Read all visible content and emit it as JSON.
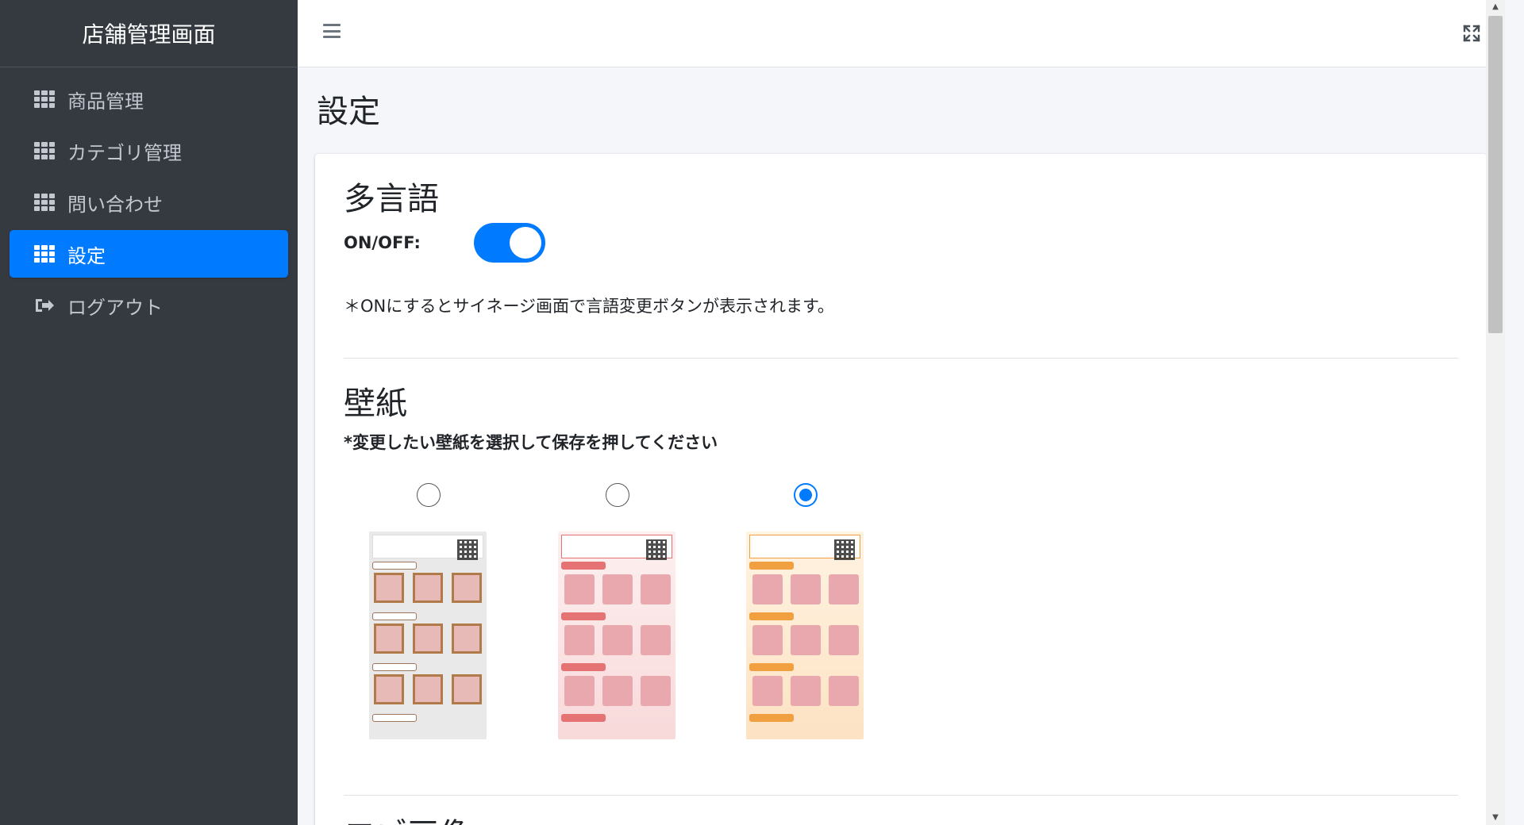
{
  "sidebar": {
    "brand": "店舗管理画面",
    "items": [
      {
        "label": "商品管理",
        "icon": "grid-icon"
      },
      {
        "label": "カテゴリ管理",
        "icon": "grid-icon"
      },
      {
        "label": "問い合わせ",
        "icon": "grid-icon"
      },
      {
        "label": "設定",
        "icon": "grid-icon",
        "active": true
      },
      {
        "label": "ログアウト",
        "icon": "sign-out-icon"
      }
    ]
  },
  "topbar": {
    "menu_icon": "hamburger-icon",
    "fullscreen_icon": "expand-icon"
  },
  "page": {
    "title": "設定"
  },
  "multilingual": {
    "title": "多言語",
    "toggle_label": "ON/OFF:",
    "toggle_on": true,
    "note": "＊ONにするとサイネージ画面で言語変更ボタンが表示されます。"
  },
  "wallpaper": {
    "title": "壁紙",
    "instruction": "*変更したい壁紙を選択して保存を押してください",
    "options": [
      {
        "theme": "gray",
        "selected": false
      },
      {
        "theme": "pink",
        "selected": false
      },
      {
        "theme": "orange",
        "selected": true
      }
    ]
  },
  "next_section": {
    "title_partial": "ロゴ画像"
  },
  "colors": {
    "sidebar_bg": "#343a40",
    "active_item": "#007bff",
    "toggle_on": "#007bff"
  }
}
